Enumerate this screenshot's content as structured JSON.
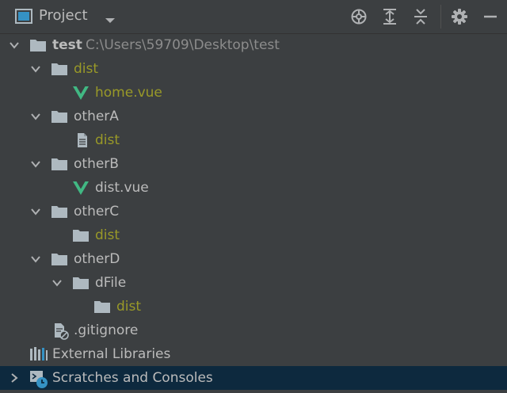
{
  "header": {
    "title": "Project",
    "icons": [
      "project-view-icon",
      "dropdown-chevron-icon",
      "locate-icon",
      "expand-all-icon",
      "collapse-all-icon",
      "gear-icon",
      "minimize-icon"
    ]
  },
  "tree": {
    "root": {
      "label": "test",
      "path": "C:\\Users\\59709\\Desktop\\test"
    },
    "items": [
      {
        "label": "dist"
      },
      {
        "label": "home.vue"
      },
      {
        "label": "otherA"
      },
      {
        "label": "dist"
      },
      {
        "label": "otherB"
      },
      {
        "label": "dist.vue"
      },
      {
        "label": "otherC"
      },
      {
        "label": "dist"
      },
      {
        "label": "otherD"
      },
      {
        "label": "dFile"
      },
      {
        "label": "dist"
      },
      {
        "label": ".gitignore"
      }
    ],
    "external_libraries": "External Libraries",
    "scratches": "Scratches and Consoles"
  },
  "colors": {
    "background": "#3c3f41",
    "selected_row": "#0d293e",
    "olive_text": "#999928",
    "vue_green": "#41b883",
    "folder": "#aeb9c0"
  }
}
